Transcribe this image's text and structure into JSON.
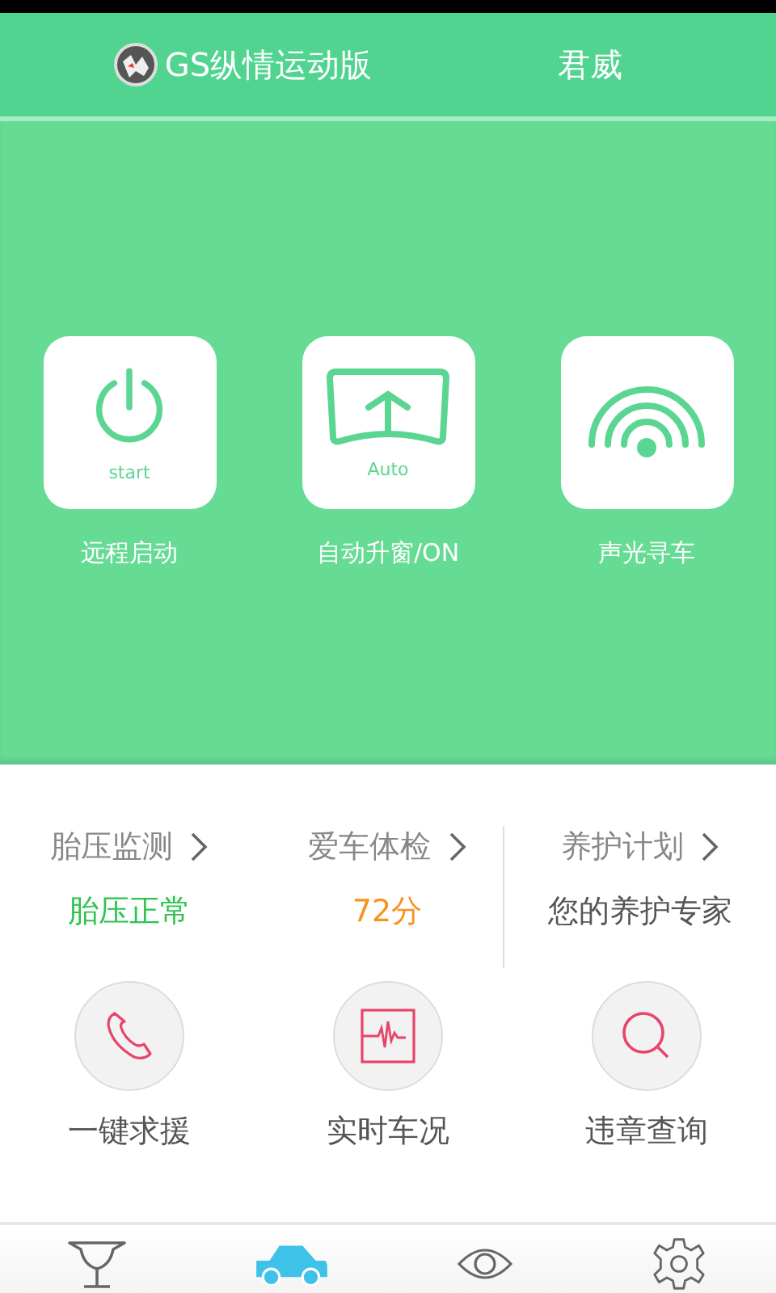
{
  "header": {
    "model": "GS纵情运动版",
    "car": "君威"
  },
  "actions": [
    {
      "kind": "power",
      "caption": "start",
      "label": "远程启动"
    },
    {
      "kind": "window",
      "caption": "Auto",
      "label": "自动升窗/ON"
    },
    {
      "kind": "signal",
      "label": "声光寻车"
    }
  ],
  "stats": [
    {
      "title": "胎压监测",
      "value": "胎压正常",
      "color": "#2ec44f"
    },
    {
      "title": "爱车体检",
      "value": "72分",
      "color": "#f7931e"
    },
    {
      "title": "养护计划",
      "value": "您的养护专家",
      "color": "#555555"
    }
  ],
  "tools": [
    {
      "kind": "phone",
      "label": "一键求援"
    },
    {
      "kind": "pulse",
      "label": "实时车况"
    },
    {
      "kind": "search",
      "label": "违章查询"
    }
  ],
  "tabs": [
    {
      "kind": "trophy",
      "selected": false
    },
    {
      "kind": "car",
      "selected": true
    },
    {
      "kind": "eye",
      "selected": false
    },
    {
      "kind": "gear",
      "selected": false
    }
  ]
}
